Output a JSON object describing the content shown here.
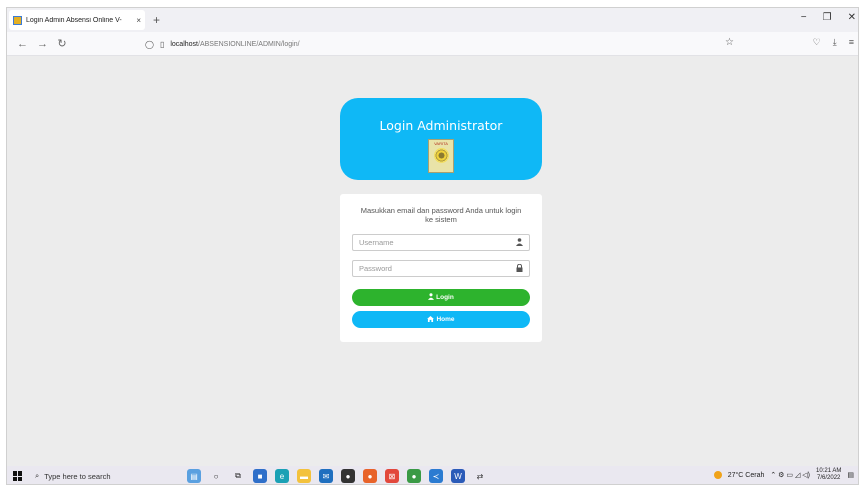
{
  "browser": {
    "tab_title": "Login Admin Absensi Online V-",
    "tab_close": "×",
    "new_tab": "+",
    "url_host": "localhost",
    "url_path": "/ABSENSIONLINE/ADMIN/login/",
    "window_controls": {
      "minimize": "−",
      "restore": "❐",
      "close": "✕"
    },
    "nav": {
      "back": "←",
      "forward": "→",
      "reload": "↻"
    }
  },
  "header": {
    "title": "Login Administrator",
    "logo_text": "VARITA"
  },
  "form": {
    "message": "Masukkan email dan password Anda untuk login ke sistem",
    "username_placeholder": "Username",
    "password_placeholder": "Password",
    "login_label": "Login",
    "home_label": "Home"
  },
  "taskbar": {
    "search_placeholder": "Type here to search",
    "weather": "27°C  Cerah",
    "time": "10:21 AM",
    "date": "7/6/2022"
  }
}
